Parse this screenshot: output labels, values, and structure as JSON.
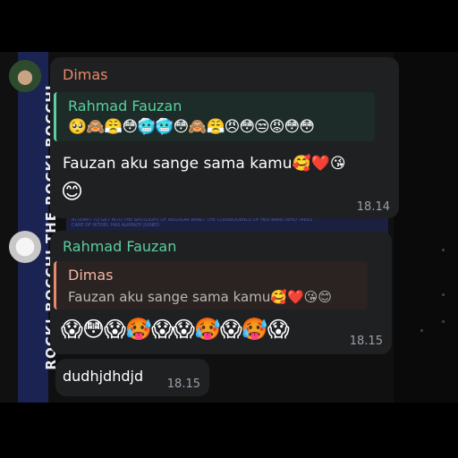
{
  "background": {
    "strip_text": "ROCK!  BOCCHI THE ROCK!  BOCCHI",
    "band_text": "ATTEMPT TO GET INTO THE SPOTLIGHT OF REGULAR BAND. THE CONSEQUENCE OF HER BAND WHO TAKES CARE OF HITORI. HAS ALREADY JOINED"
  },
  "messages": [
    {
      "sender": "Dimas",
      "reply_to": "Rahmad Fauzan",
      "reply_text": "🥺🙈😤😳🥶🥶😳🙈😤😠😳😒😡😳😳",
      "text": "Fauzan aku sange sama kamu🥰❤️😘",
      "emoji": "😊",
      "time": "18.14"
    },
    {
      "sender": "Rahmad Fauzan",
      "reply_to": "Dimas",
      "reply_text": "Fauzan aku sange sama kamu🥰❤️😘😊",
      "text": "😱😳😱🥵😱😱🥵😱🥵😱",
      "time": "18.15"
    },
    {
      "text": "dudhjdhdjd",
      "time": "18.15"
    }
  ],
  "colors": {
    "dimas_name": "#e8896a",
    "rahmad_name": "#5bcfa0",
    "bubble": "#1f2022"
  }
}
